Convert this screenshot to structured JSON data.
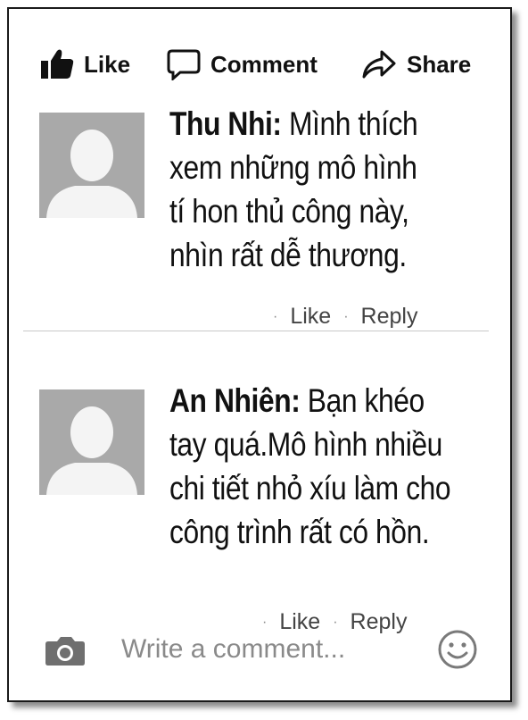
{
  "actions": {
    "like_label": "Like",
    "comment_label": "Comment",
    "share_label": "Share"
  },
  "comments": [
    {
      "author": "Thu Nhi:",
      "lines": [
        "Mình thích",
        "xem những mô hình",
        "tí hon thủ công này,",
        "nhìn rất dễ thương."
      ],
      "like_label": "Like",
      "reply_label": "Reply"
    },
    {
      "author": "An Nhiên:",
      "lines": [
        "Bạn khéo",
        "tay quá.Mô hình nhiều",
        "chi tiết nhỏ xíu làm cho",
        "công trình rất có hồn."
      ],
      "like_label": "Like",
      "reply_label": "Reply"
    }
  ],
  "composer": {
    "placeholder": "Write a comment...",
    "camera_icon": "camera-icon",
    "emoji_icon": "smiley-icon"
  }
}
